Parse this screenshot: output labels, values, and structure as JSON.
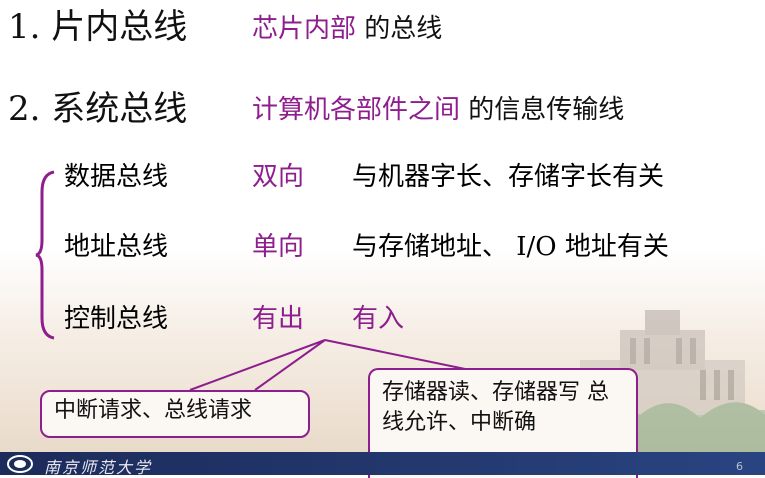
{
  "items": [
    {
      "title": "1. 片内总线",
      "highlight": "芯片内部",
      "suffix": " 的总线"
    },
    {
      "title": "2. 系统总线",
      "highlight": "计算机各部件之间",
      "suffix": " 的信息传输线"
    }
  ],
  "buses": [
    {
      "name": "数据总线",
      "direction": "双向",
      "note": "与机器字长、存储字长有关"
    },
    {
      "name": "地址总线",
      "direction": "单向",
      "note_a": "与存储地址、 ",
      "note_io": "I/O",
      "note_b": " 地址有关"
    },
    {
      "name": "控制总线",
      "direction_out": "有出",
      "direction_in": "有入"
    }
  ],
  "callouts": {
    "out_text": "中断请求、总线请求",
    "in_text": "存储器读、存储器写 总线允许、中断确"
  },
  "footer": {
    "school": "南京师范大学",
    "page": "6"
  }
}
